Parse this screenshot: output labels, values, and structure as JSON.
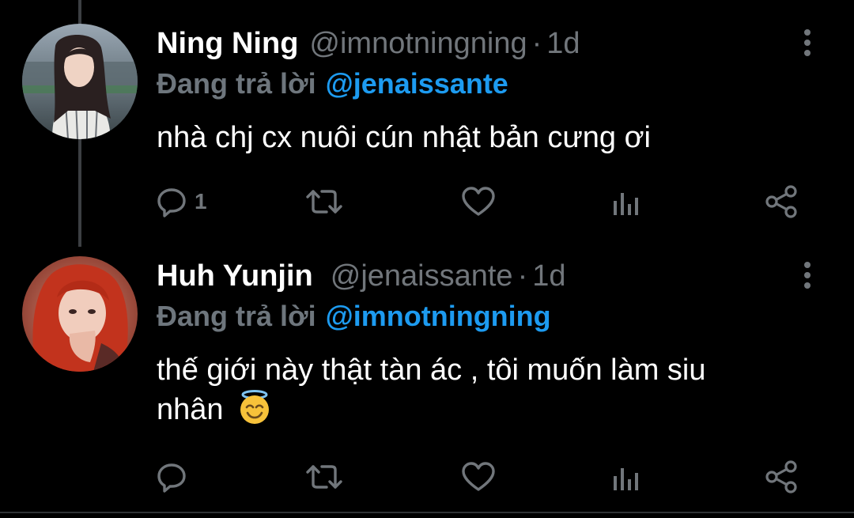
{
  "thread": {
    "tweets": [
      {
        "author_name": "Ning Ning",
        "handle": "@imnotningning",
        "separator": "·",
        "time": "1d",
        "reply_prefix": "Đang trả lời",
        "reply_to": "@jenaissante",
        "text": "nhà chj cx nuôi cún nhật bản cưng ơi",
        "reply_count": "1",
        "avatar_icon": "woman-portrait-photo"
      },
      {
        "author_name": "Huh Yunjin",
        "handle": "@jenaissante",
        "separator": "·",
        "time": "1d",
        "reply_prefix": "Đang trả lời",
        "reply_to": "@imnotningning",
        "text_line1": "thế giới này thật tàn ác , tôi muốn làm siu",
        "text_line2": "nhân",
        "emoji": "smiling-face-with-halo",
        "reply_count": "",
        "avatar_icon": "woman-red-hair-photo"
      }
    ]
  },
  "icons": {
    "reply": "reply-icon",
    "retweet": "retweet-icon",
    "like": "heart-icon",
    "views": "analytics-icon",
    "share": "share-icon",
    "more": "more-icon"
  },
  "colors": {
    "background": "#000000",
    "text": "#ffffff",
    "secondary": "#71767b",
    "mention": "#1d9bf0",
    "thread_line": "#3c3f43"
  }
}
